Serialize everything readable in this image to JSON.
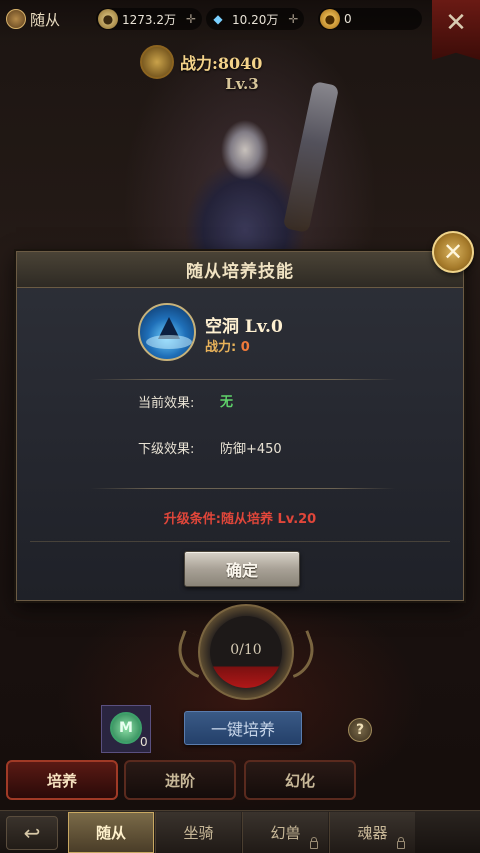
{
  "topbar": {
    "title": "随从",
    "resources": [
      {
        "icon": "silver-coin-icon",
        "value": "1273.2万"
      },
      {
        "icon": "diamond-icon",
        "value": "10.20万"
      },
      {
        "icon": "gold-ingot-icon",
        "value": "0"
      }
    ]
  },
  "hero": {
    "power_label": "战力:8040",
    "level": "Lv.3"
  },
  "dialog": {
    "title": "随从培养技能",
    "skill_name": "空洞  Lv.0",
    "skill_power_label": "战力:",
    "skill_power_value": "0",
    "current_effect_label": "当前效果:",
    "current_effect_value": "无",
    "next_effect_label": "下级效果:",
    "next_effect_value": "防御+450",
    "upgrade_condition": "升级条件:随从培养 Lv.20",
    "confirm_label": "确定"
  },
  "progress": {
    "text": "0/10",
    "value": 0.0
  },
  "item": {
    "count": "0"
  },
  "actions": {
    "one_key_label": "一键培养",
    "help_label": "?"
  },
  "subtabs": [
    {
      "label": "培养",
      "active": true
    },
    {
      "label": "进阶",
      "active": false
    },
    {
      "label": "幻化",
      "active": false
    }
  ],
  "nav": [
    {
      "label": "随从",
      "active": true,
      "locked": false
    },
    {
      "label": "坐骑",
      "active": false,
      "locked": false
    },
    {
      "label": "幻兽",
      "active": false,
      "locked": true
    },
    {
      "label": "魂器",
      "active": false,
      "locked": true
    }
  ],
  "colors": {
    "condition_red": "#e0463a",
    "effect_none_green": "#5fd16a",
    "power_orange": "#f07a3a"
  }
}
